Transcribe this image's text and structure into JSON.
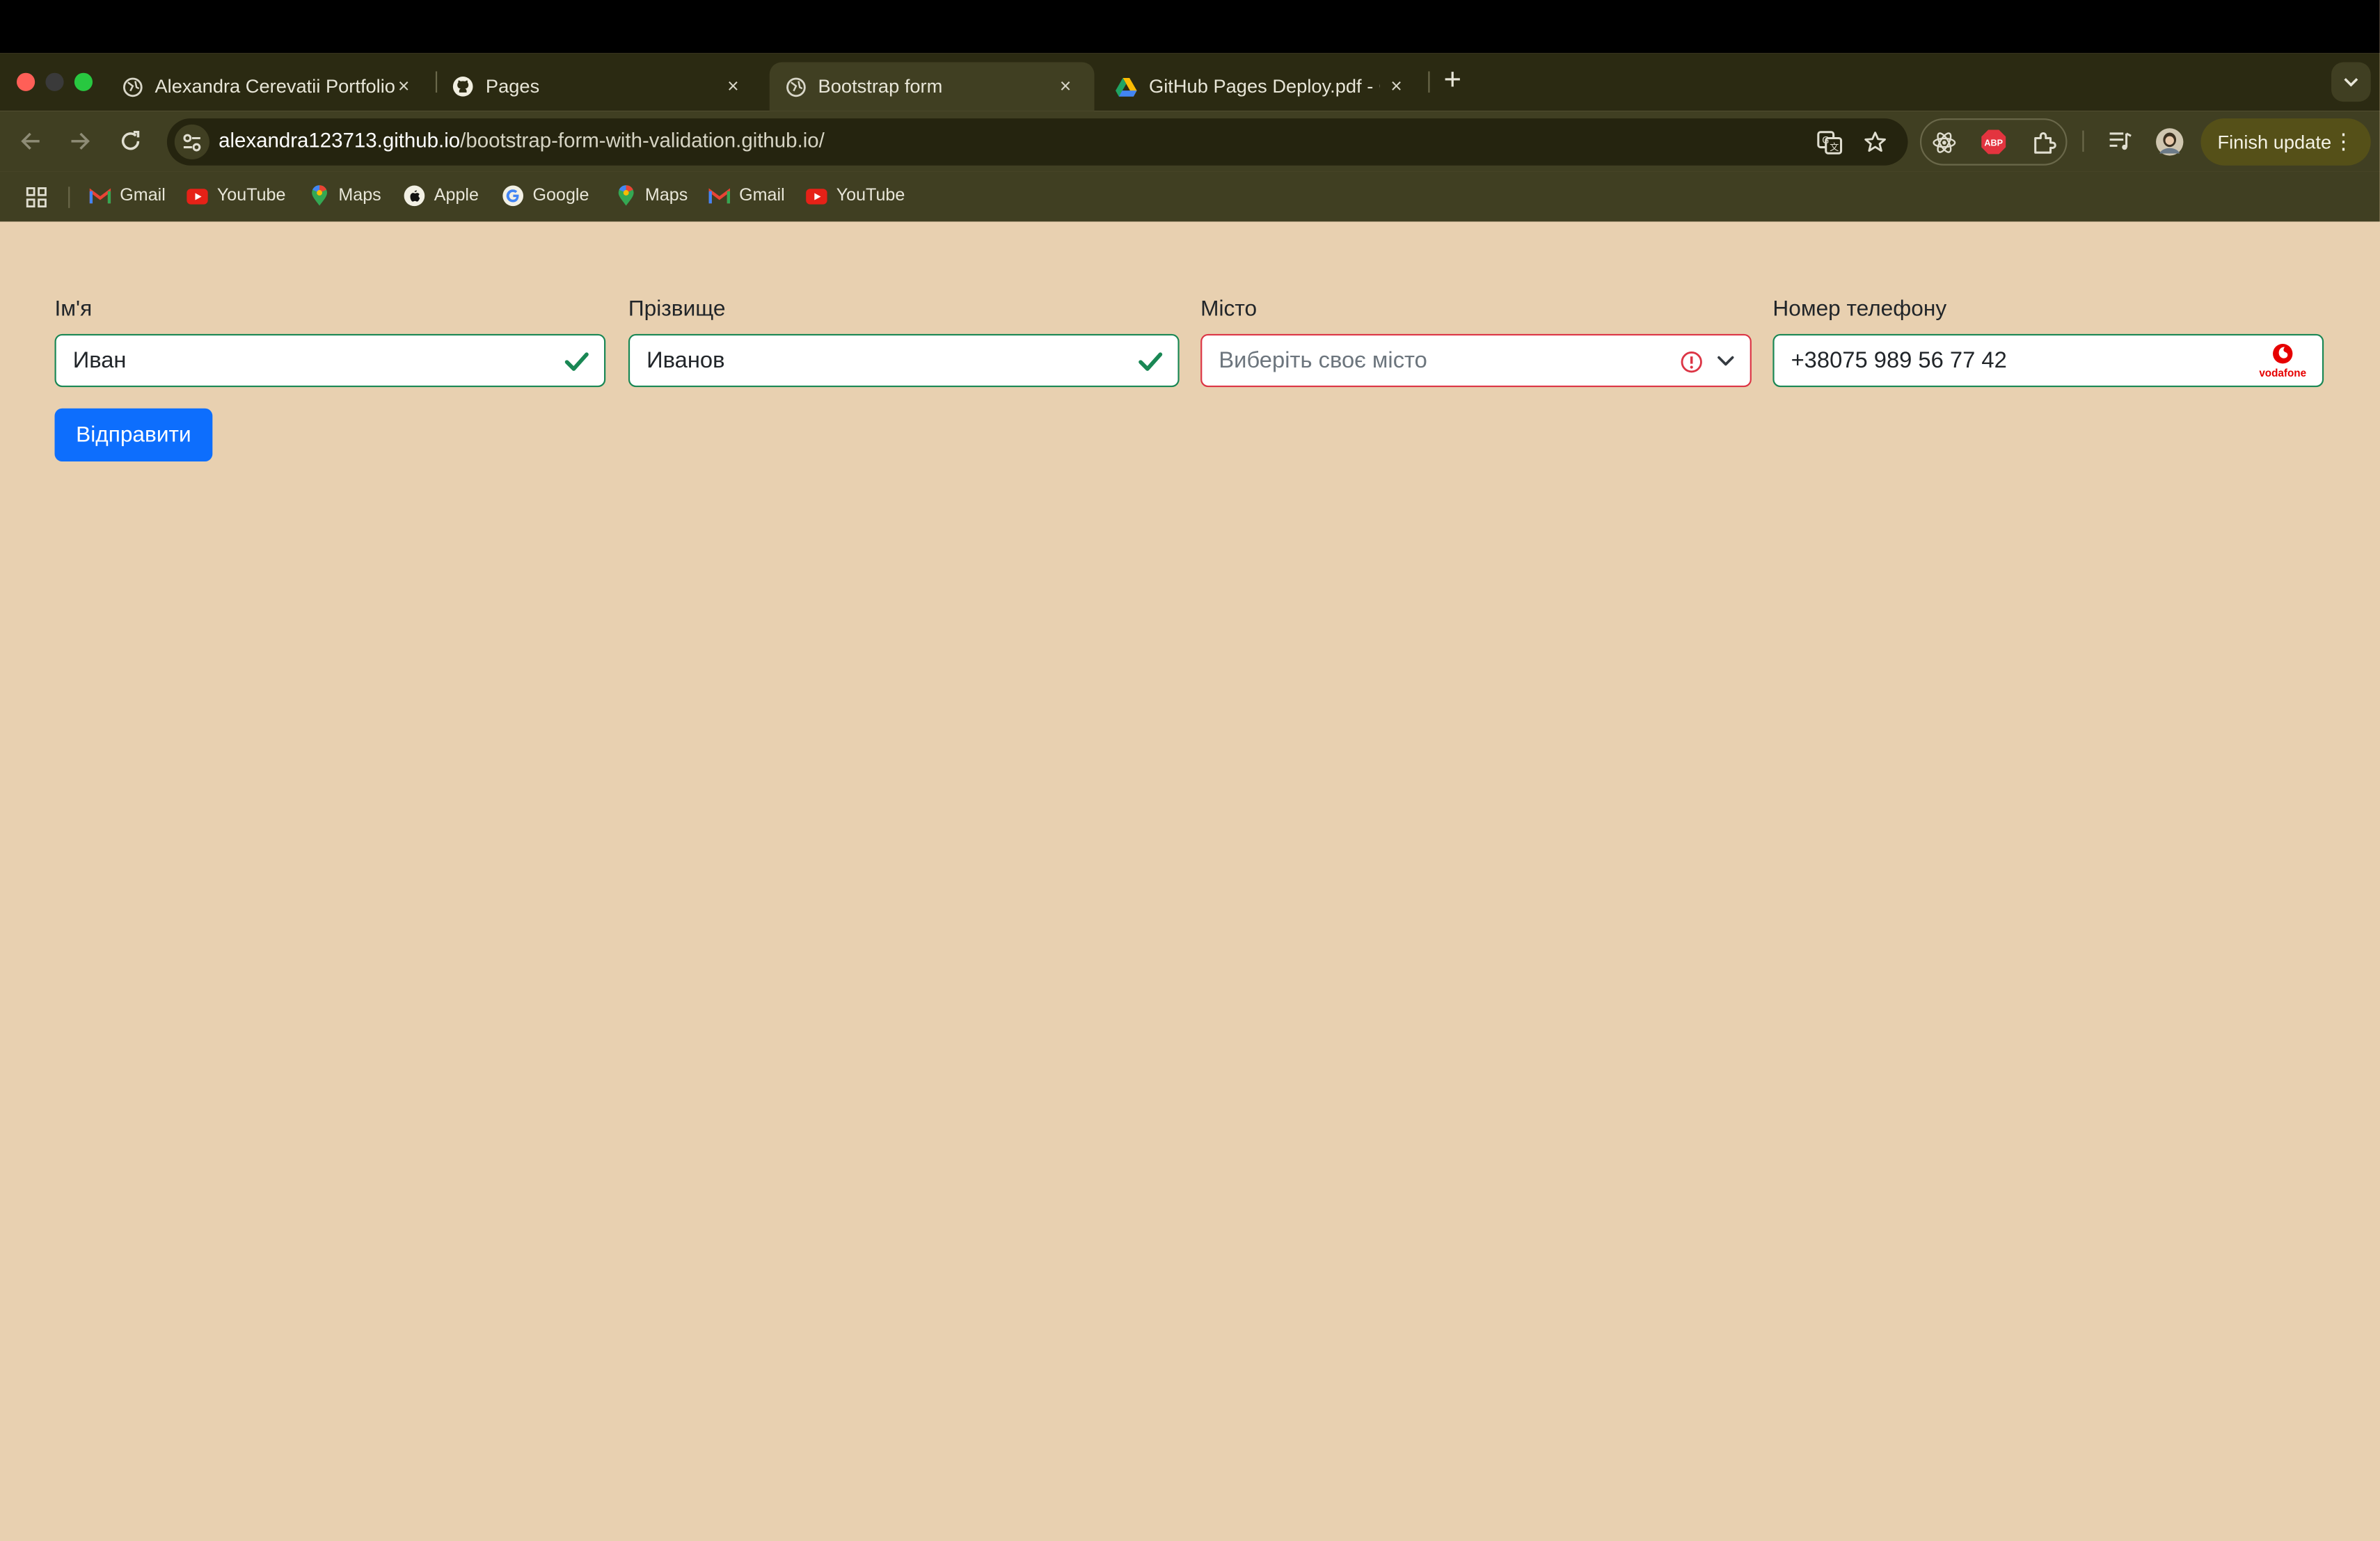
{
  "window": {
    "traffic_colors": [
      "#ff5f57",
      "#3a3a3a",
      "#28c840"
    ]
  },
  "tabs": [
    {
      "label": "Alexandra Cerevatii Portfolio",
      "icon": "globe-icon",
      "active": false
    },
    {
      "label": "Pages",
      "icon": "github-icon",
      "active": false
    },
    {
      "label": "Bootstrap form",
      "icon": "globe-icon",
      "active": true
    },
    {
      "label": "GitHub Pages Deploy.pdf - Go",
      "icon": "google-drive-icon",
      "active": false
    }
  ],
  "tab_close": "×",
  "new_tab": "+",
  "address_bar": {
    "host": "alexandra123713.github.io",
    "path": "/bootstrap-form-with-validation.github.io/"
  },
  "toolbar": {
    "finish_update_label": "Finish update",
    "abp_label": "ABP"
  },
  "bookmarks": [
    {
      "label": "Gmail",
      "icon": "gmail-icon"
    },
    {
      "label": "YouTube",
      "icon": "youtube-icon"
    },
    {
      "label": "Maps",
      "icon": "maps-icon"
    },
    {
      "label": "Apple",
      "icon": "apple-icon"
    },
    {
      "label": "Google",
      "icon": "google-icon"
    },
    {
      "label": "Maps",
      "icon": "maps-icon"
    },
    {
      "label": "Gmail",
      "icon": "gmail-icon"
    },
    {
      "label": "YouTube",
      "icon": "youtube-icon"
    }
  ],
  "form": {
    "first_name": {
      "label": "Ім'я",
      "value": "Иван",
      "state": "valid"
    },
    "last_name": {
      "label": "Прізвище",
      "value": "Иванов",
      "state": "valid"
    },
    "city": {
      "label": "Місто",
      "placeholder": "Виберіть своє місто",
      "state": "invalid"
    },
    "phone": {
      "label": "Номер телефону",
      "value": "+38075 989 56 77 42",
      "operator_logo_text": "vodafone"
    },
    "submit_label": "Відправити"
  },
  "colors": {
    "page_background": "#e8d0b0",
    "valid": "#198754",
    "invalid": "#dc3545",
    "primary": "#0d6efd"
  }
}
